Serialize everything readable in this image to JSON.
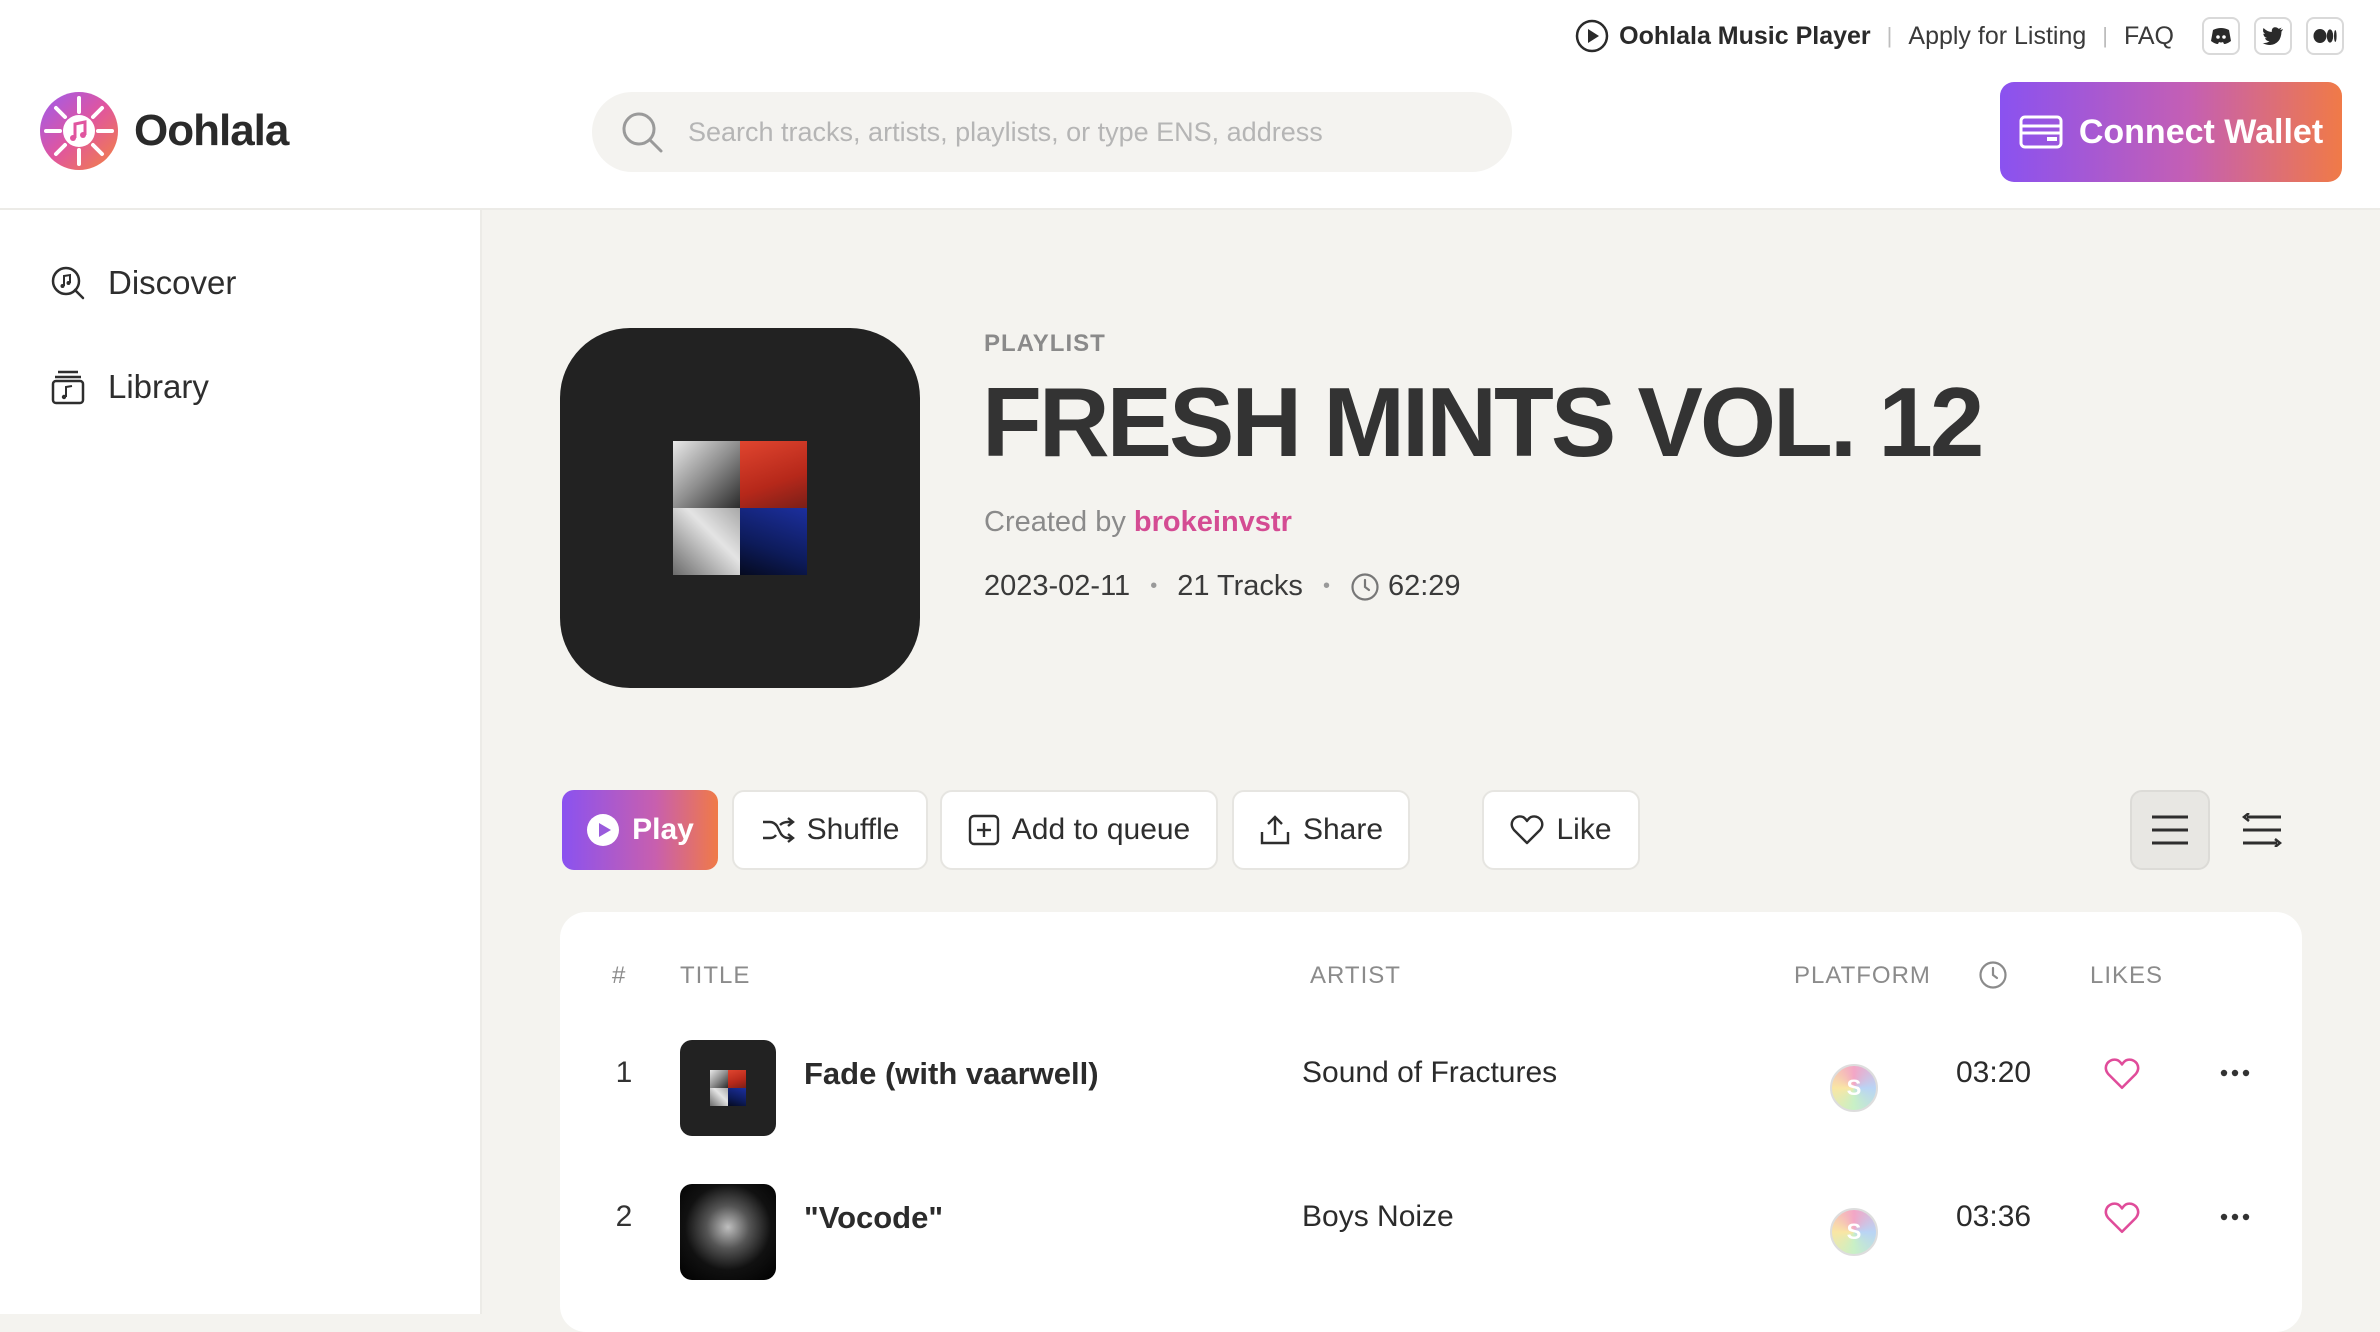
{
  "header": {
    "brand": "Oohlala",
    "utility": {
      "player_label": "Oohlala Music Player",
      "apply_label": "Apply for Listing",
      "faq_label": "FAQ",
      "sep": "|"
    },
    "search": {
      "placeholder": "Search tracks, artists, playlists, or type ENS, address"
    },
    "connect_label": "Connect Wallet"
  },
  "sidebar": {
    "items": [
      {
        "label": "Discover",
        "icon": "discover-icon"
      },
      {
        "label": "Library",
        "icon": "library-icon"
      }
    ]
  },
  "playlist": {
    "type_label": "PLAYLIST",
    "title": "FRESH MINTS VOL. 12",
    "created_by_prefix": "Created by",
    "creator": "brokeinvstr",
    "date": "2023-02-11",
    "tracks": "21 Tracks",
    "duration": "62:29",
    "dot": "•"
  },
  "actions": {
    "play": "Play",
    "shuffle": "Shuffle",
    "queue": "Add to queue",
    "share": "Share",
    "like": "Like"
  },
  "table": {
    "headers": {
      "num": "#",
      "title": "TITLE",
      "artist": "ARTIST",
      "platform": "PLATFORM",
      "likes": "LIKES"
    },
    "rows": [
      {
        "num": "1",
        "title": "Fade (with vaarwell)",
        "artist": "Sound of Fractures",
        "platform_glyph": "S",
        "duration": "03:20"
      },
      {
        "num": "2",
        "title": "\"Vocode\"",
        "artist": "Boys Noize",
        "platform_glyph": "S",
        "duration": "03:36"
      }
    ]
  },
  "colors": {
    "accent_pink": "#d44c93",
    "gradient_start": "#8a52f0",
    "gradient_end": "#f07a47"
  }
}
